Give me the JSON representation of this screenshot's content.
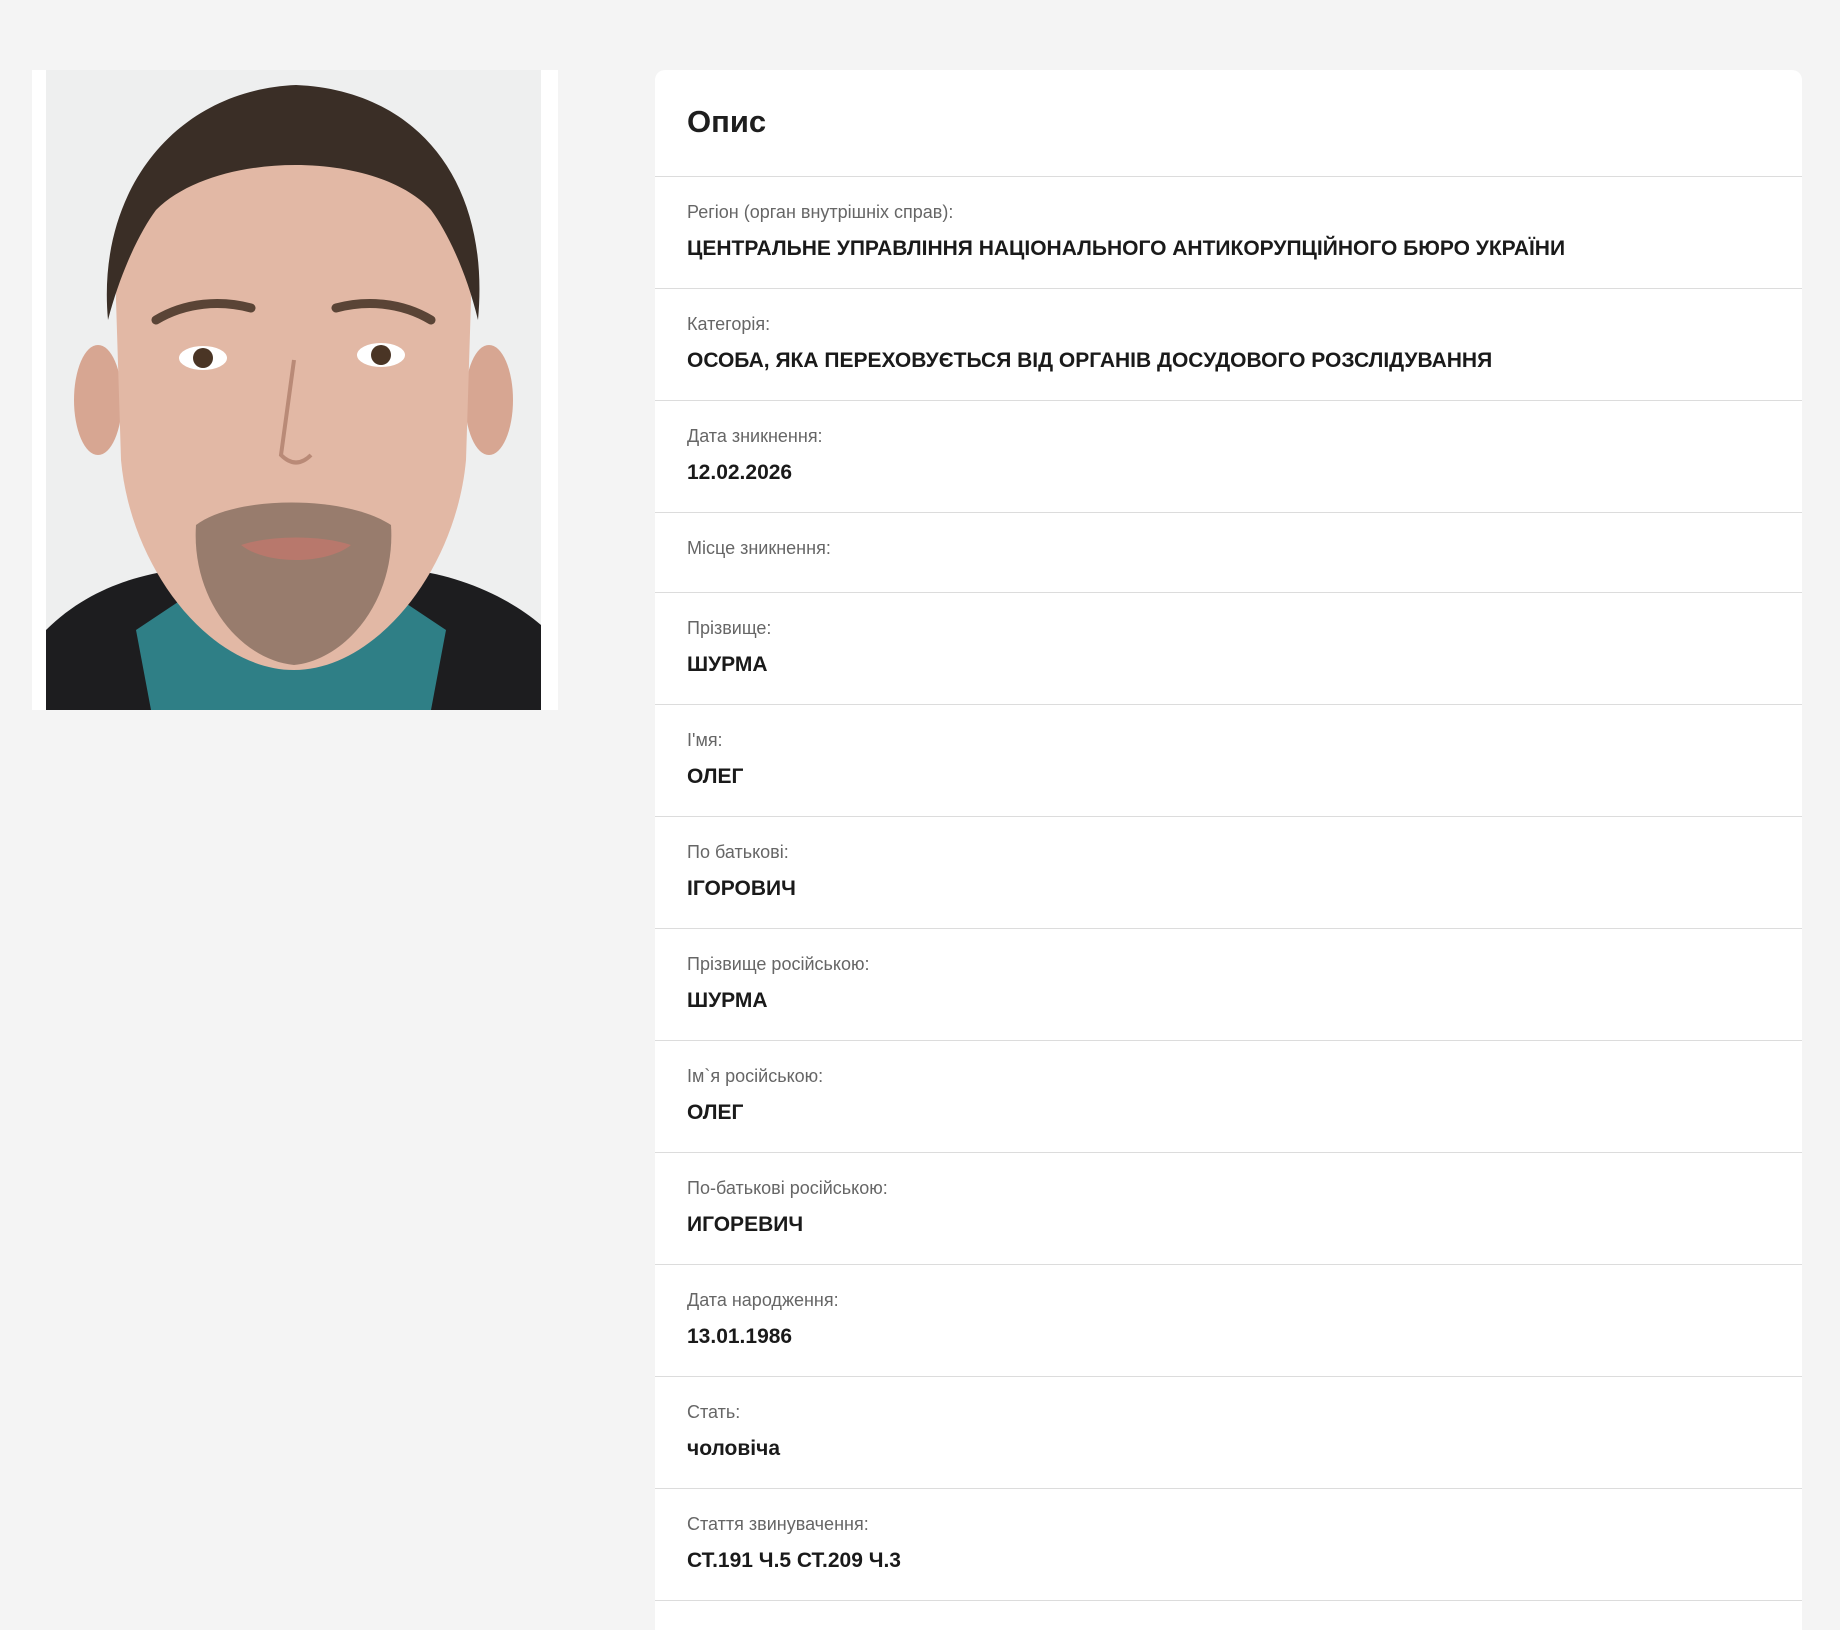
{
  "photo": {
    "subject": "portrait-photo"
  },
  "card": {
    "title": "Опис",
    "rows": [
      {
        "label": "Регіон (орган внутрішніх справ):",
        "value": "ЦЕНТРАЛЬНЕ УПРАВЛІННЯ НАЦІОНАЛЬНОГО АНТИКОРУПЦІЙНОГО БЮРО УКРАЇНИ"
      },
      {
        "label": "Категорія:",
        "value": "ОСОБА, ЯКА ПЕРЕХОВУЄТЬСЯ ВІД ОРГАНІВ ДОСУДОВОГО РОЗСЛІДУВАННЯ"
      },
      {
        "label": "Дата зникнення:",
        "value": "12.02.2026"
      },
      {
        "label": "Місце зникнення:",
        "value": ""
      },
      {
        "label": "Прізвище:",
        "value": "ШУРМА"
      },
      {
        "label": "І'мя:",
        "value": "ОЛЕГ"
      },
      {
        "label": "По батькові:",
        "value": "ІГОРОВИЧ"
      },
      {
        "label": "Прізвище російською:",
        "value": "ШУРМА"
      },
      {
        "label": "Ім`я російською:",
        "value": "ОЛЕГ"
      },
      {
        "label": "По-батькові російською:",
        "value": "ИГОРЕВИЧ"
      },
      {
        "label": "Дата народження:",
        "value": "13.01.1986"
      },
      {
        "label": "Стать:",
        "value": "чоловіча"
      },
      {
        "label": "Стаття звинувачення:",
        "value": "СТ.191 Ч.5 СТ.209 Ч.3"
      }
    ]
  },
  "colors": {
    "page_background": "#f4f4f4",
    "card_background": "#ffffff",
    "divider": "#dcdcdc",
    "label_text": "#666666",
    "value_text": "#1a1a1a"
  }
}
